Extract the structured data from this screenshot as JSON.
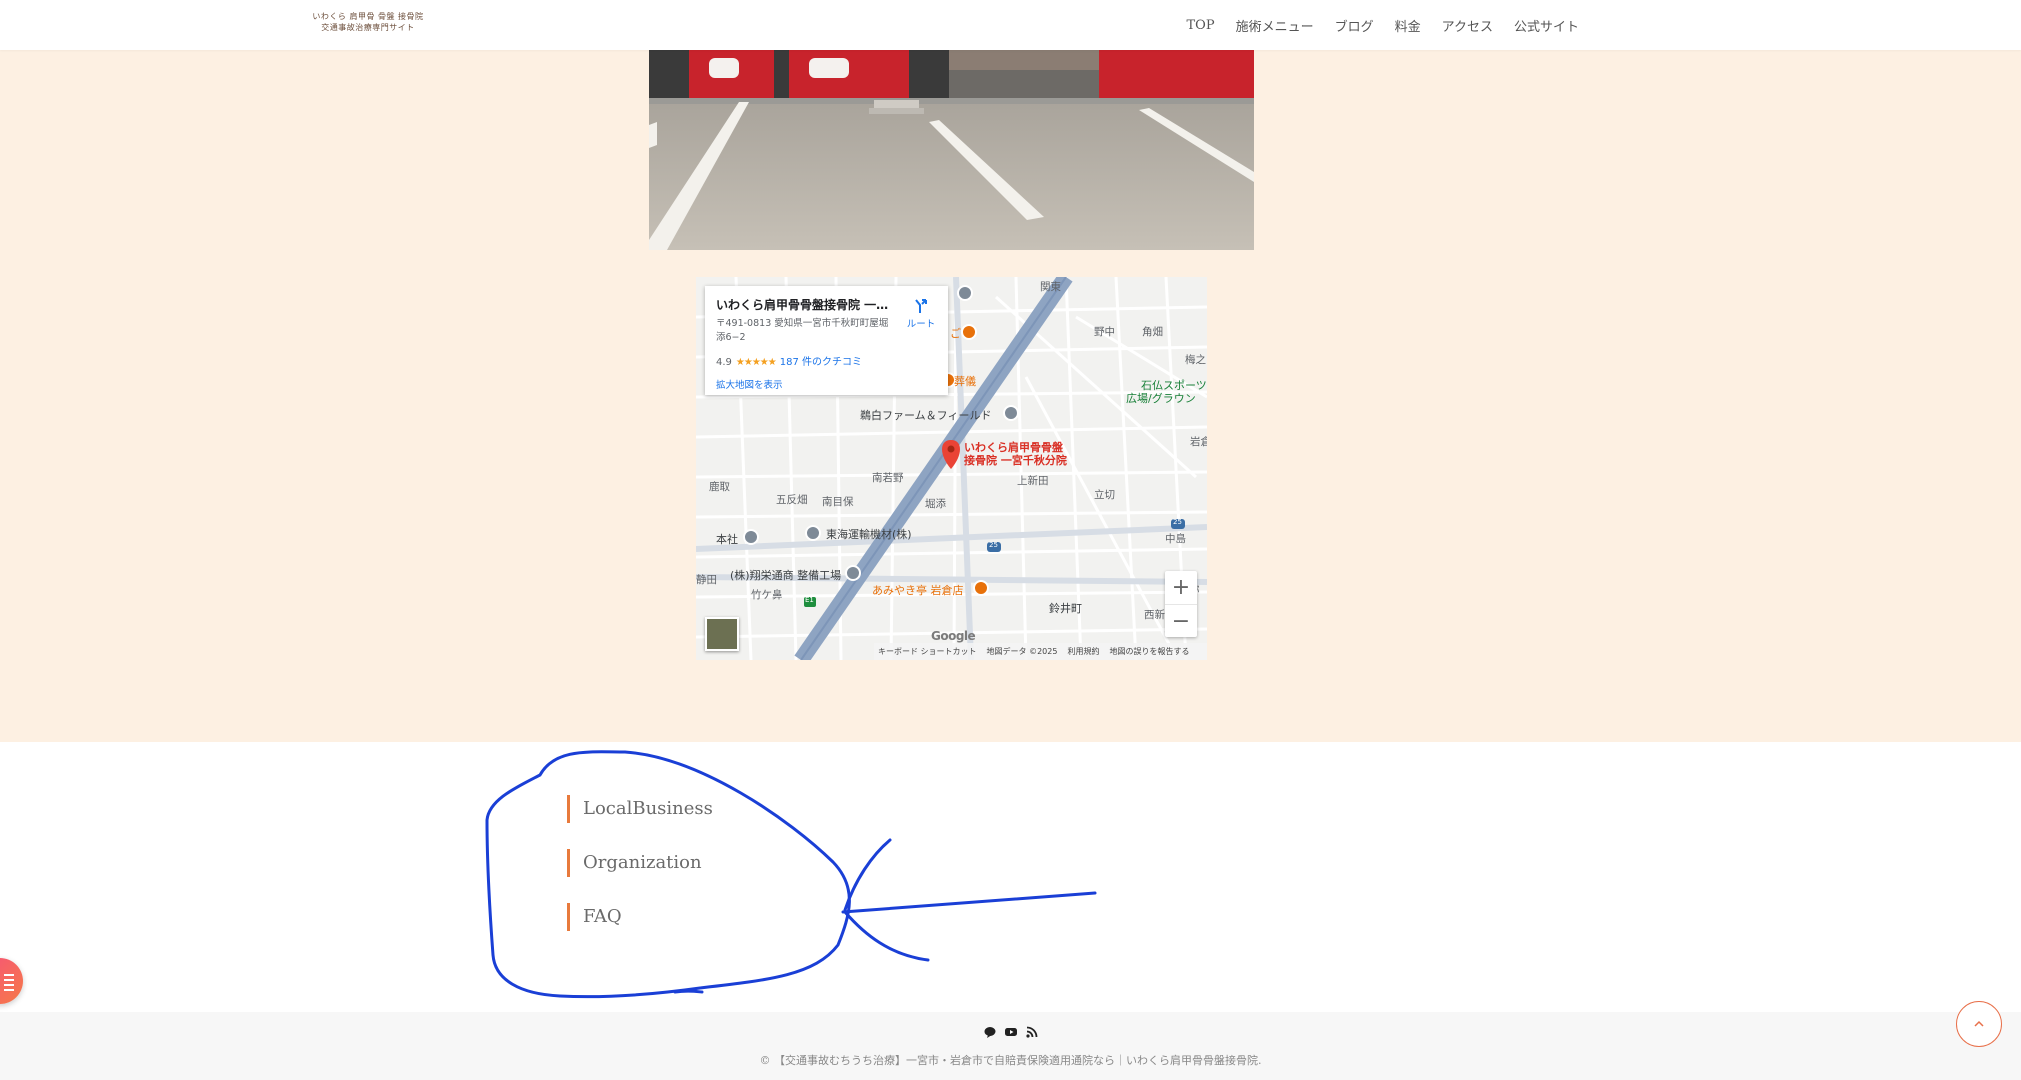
{
  "header": {
    "logo_line1": "いわくら 肩甲骨 骨盤 接骨院",
    "logo_line2": "交通事故治療専門サイト",
    "nav": [
      "TOP",
      "施術メニュー",
      "ブログ",
      "料金",
      "アクセス",
      "公式サイト"
    ]
  },
  "map": {
    "place_name": "いわくら肩甲骨骨盤接骨院 一…",
    "address": "〒491-0813 愛知県一宮市千秋町町屋堀添6−2",
    "rating": "4.9",
    "stars": "★★★★★",
    "reviews": "187 件のクチコミ",
    "larger_map": "拡大地図を表示",
    "route": "ルート",
    "pin_label_line1": "いわくら肩甲骨骨盤",
    "pin_label_line2": "接骨院 一宮千秋分院",
    "labels": {
      "l1": "野中",
      "l2": "角畑",
      "l3": "梅之",
      "l4": "石仏スポーツ",
      "l5": "広場/グラウン",
      "l6": "鵜白ファーム＆フィールド",
      "l7": "岩倉",
      "l8": "南若野",
      "l9": "上新田",
      "l10": "鹿取",
      "l11": "五反畑",
      "l12": "南目保",
      "l13": "堀添",
      "l14": "立切",
      "l15": "本社",
      "l16": "東海運輸機材(株)",
      "l17": "中島",
      "l18": "(株)翔栄通商 整備工場",
      "l19": "竹ケ鼻",
      "l20": "あみやき亭 岩倉店",
      "l21": "鈴井町",
      "l22": "西新",
      "l23": "関東",
      "l24": "弥",
      "l25": "静田",
      "l26": "葬儀",
      "l27": "ご",
      "road_25": "25",
      "road_e1": "E1"
    },
    "zoom_in": "+",
    "zoom_out": "−",
    "google": "Google",
    "footer": {
      "shortcuts": "キーボード ショートカット",
      "map_data": "地図データ ©2025",
      "terms": "利用規約",
      "report": "地図の誤りを報告する"
    }
  },
  "schema_links": [
    "LocalBusiness",
    "Organization",
    "FAQ"
  ],
  "footer": {
    "copyright": "© 【交通事故むちうち治療】一宮市・岩倉市で自賠責保険適用通院なら｜いわくら肩甲骨骨盤接骨院."
  },
  "colors": {
    "peach": "#fdf0e2",
    "accent": "#e87a3c",
    "annotation": "#1a3fd6"
  }
}
